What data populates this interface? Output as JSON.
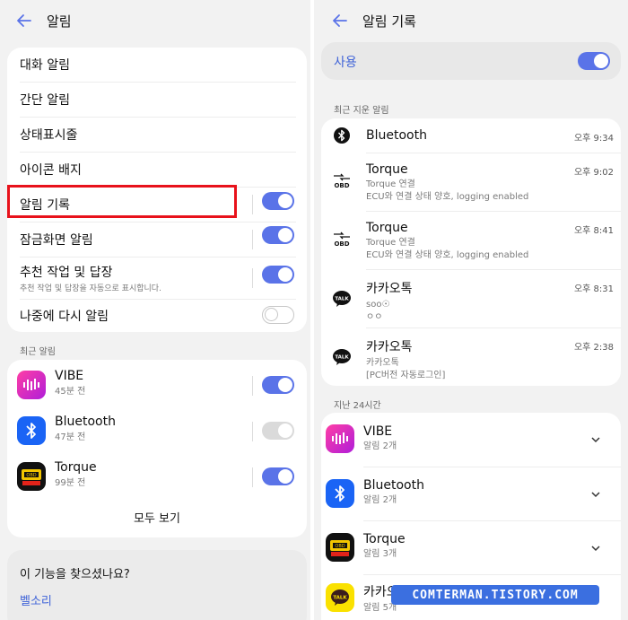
{
  "left": {
    "title": "알림",
    "settings": [
      {
        "label": "대화 알림"
      },
      {
        "label": "간단 알림"
      },
      {
        "label": "상태표시줄"
      },
      {
        "label": "아이콘 배지"
      },
      {
        "label": "알림 기록",
        "toggle": "on"
      },
      {
        "label": "잠금화면 알림",
        "toggle": "on"
      },
      {
        "label": "추천 작업 및 답장",
        "sub": "추천 작업 및 답장을 자동으로 표시합니다.",
        "toggle": "on"
      },
      {
        "label": "나중에 다시 알림",
        "toggle": "off"
      }
    ],
    "recent_label": "최근 알림",
    "recent_apps": [
      {
        "name": "VIBE",
        "time": "45분 전",
        "toggle": "on",
        "icon": "vibe-icon"
      },
      {
        "name": "Bluetooth",
        "time": "47분 전",
        "toggle": "disabled",
        "icon": "bluetooth-icon"
      },
      {
        "name": "Torque",
        "time": "99분 전",
        "toggle": "on",
        "icon": "torque-icon"
      }
    ],
    "view_all": "모두 보기",
    "suggestion_title": "이 기능을 찾으셨나요?",
    "suggestion_link": "벨소리"
  },
  "right": {
    "title": "알림 기록",
    "use_label": "사용",
    "use_toggle": "on",
    "recent_deleted_label": "최근 지운 알림",
    "notifications": [
      {
        "app": "Bluetooth",
        "time": "오후 9:34",
        "icon": "bluetooth-icon"
      },
      {
        "app": "Torque",
        "line1": "Torque 연결",
        "line2": "ECU와 연결 상태 양호, logging enabled",
        "time": "오후 9:02",
        "icon": "obd-icon"
      },
      {
        "app": "Torque",
        "line1": "Torque 연결",
        "line2": "ECU와 연결 상태 양호, logging enabled",
        "time": "오후 8:41",
        "icon": "obd-icon"
      },
      {
        "app": "카카오톡",
        "line1": "soo☉",
        "line2": "ㅇㅇ",
        "time": "오후 8:31",
        "icon": "kakaotalk-icon"
      },
      {
        "app": "카카오톡",
        "line1": "카카오톡",
        "line2": "[PC버전 자동로그인]",
        "time": "오후 2:38",
        "icon": "kakaotalk-icon"
      }
    ],
    "last24_label": "지난 24시간",
    "last24": [
      {
        "app": "VIBE",
        "count": "알림 2개",
        "icon": "vibe-icon"
      },
      {
        "app": "Bluetooth",
        "count": "알림 2개",
        "icon": "bluetooth-icon"
      },
      {
        "app": "Torque",
        "count": "알림 3개",
        "icon": "torque-icon"
      },
      {
        "app": "카카오톡",
        "count": "알림 5개",
        "icon": "kakaotalk-icon"
      }
    ]
  },
  "watermark": "COMTERMAN.TISTORY.COM",
  "colors": {
    "accent": "#5a73e8",
    "highlight": "#e8121b",
    "background": "#f2f2f2"
  }
}
